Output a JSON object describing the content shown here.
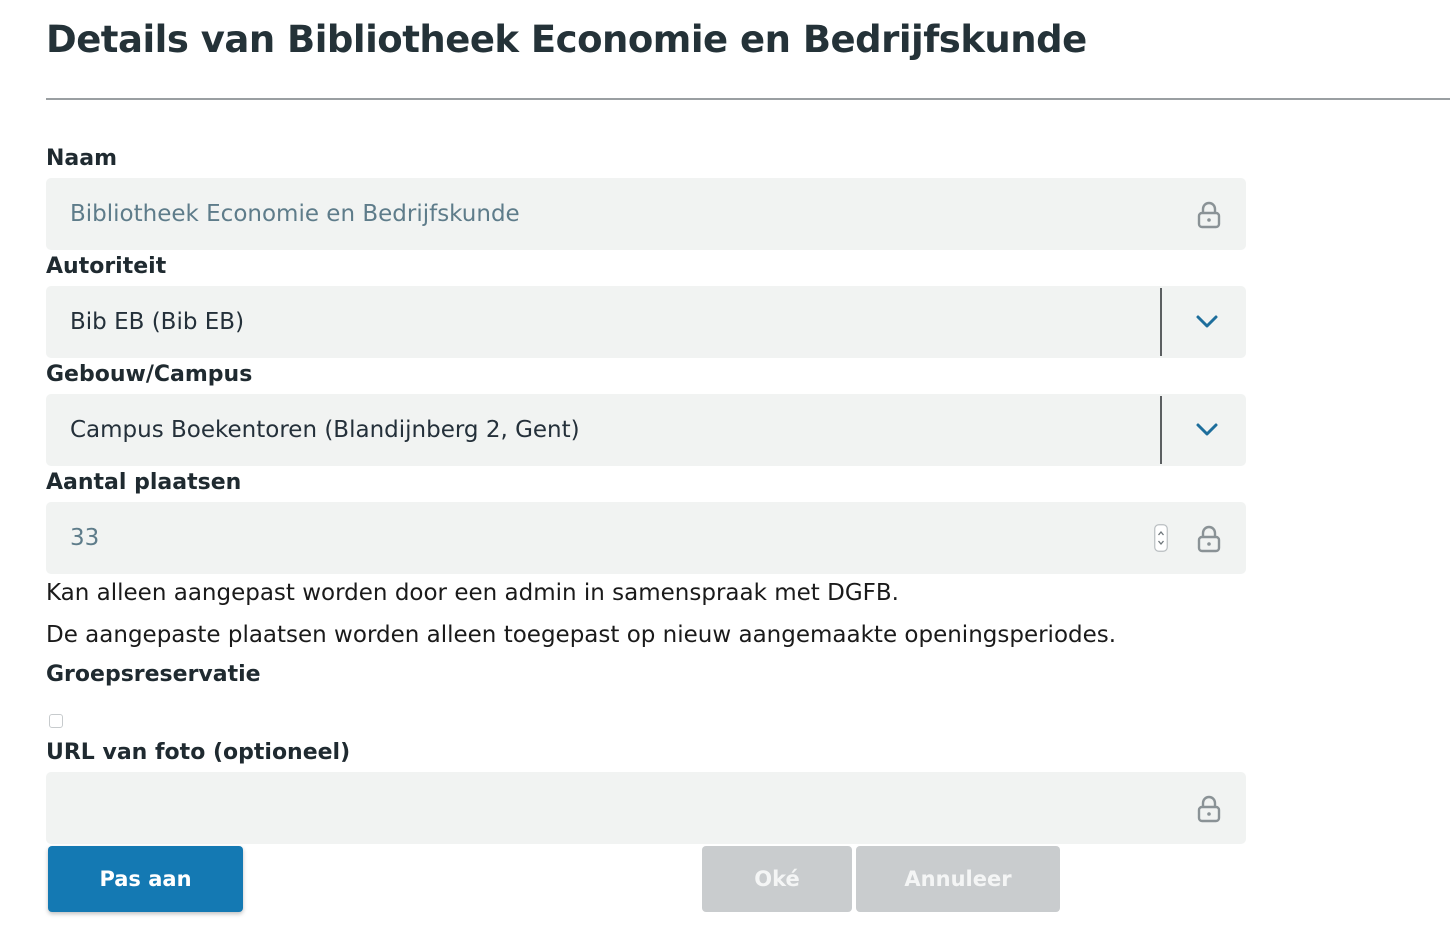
{
  "page": {
    "title": "Details van Bibliotheek Economie en Bedrijfskunde"
  },
  "form": {
    "naam": {
      "label": "Naam",
      "value": "Bibliotheek Economie en Bedrijfskunde",
      "locked": true
    },
    "autoriteit": {
      "label": "Autoriteit",
      "selected": "Bib EB (Bib EB)"
    },
    "gebouw": {
      "label": "Gebouw/Campus",
      "selected": "Campus Boekentoren (Blandijnberg 2, Gent)"
    },
    "plaatsen": {
      "label": "Aantal plaatsen",
      "value": "33",
      "locked": true,
      "note_1": "Kan alleen aangepast worden door een admin in samenspraak met DGFB.",
      "note_2": "De aangepaste plaatsen worden alleen toegepast op nieuw aangemaakte openingsperiodes."
    },
    "groepsreservatie": {
      "label": "Groepsreservatie",
      "checked": false
    },
    "foto_url": {
      "label": "URL van foto (optioneel)",
      "value": "",
      "locked": true
    }
  },
  "buttons": {
    "edit_label": "Pas aan",
    "ok_label": "Oké",
    "cancel_label": "Annuleer"
  },
  "icons": {
    "lock": "lock-icon",
    "dropdown": "chevron-down-icon",
    "spinner": "number-spinner-icon"
  },
  "colors": {
    "primary_button": "#1479b3",
    "disabled_button": "#c9ccce",
    "field_background": "#f1f3f2",
    "locked_text": "#5e7c8a",
    "chevron": "#1d6e9c"
  }
}
